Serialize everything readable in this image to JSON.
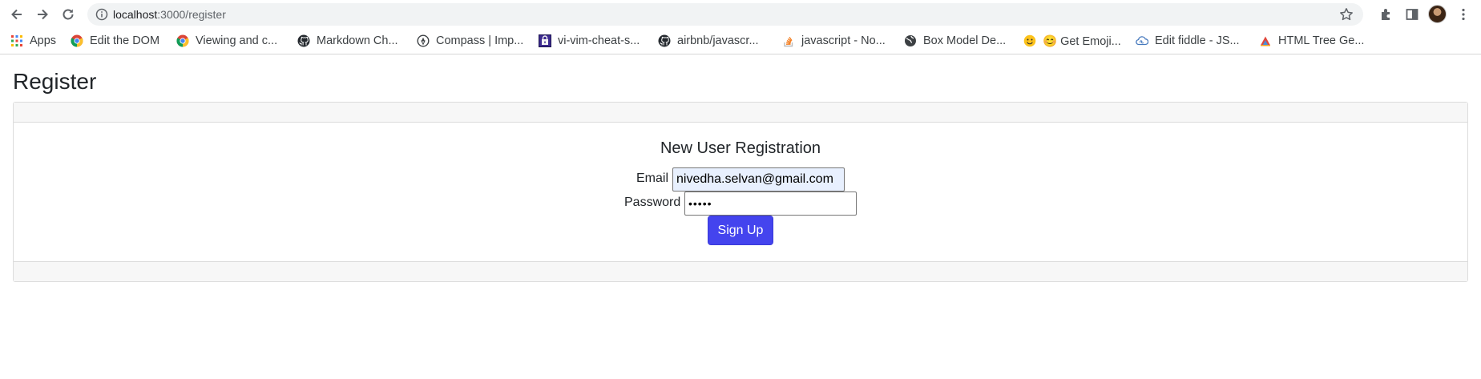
{
  "browser": {
    "url_host": "localhost",
    "url_path": ":3000/register"
  },
  "bookmarks": [
    {
      "label": "Apps",
      "icon": "apps-grid-icon"
    },
    {
      "label": "Edit the DOM",
      "icon": "chrome-icon"
    },
    {
      "label": "Viewing and c...",
      "icon": "chrome-icon"
    },
    {
      "label": "Markdown Ch...",
      "icon": "github-icon"
    },
    {
      "label": "Compass | Imp...",
      "icon": "compass-icon"
    },
    {
      "label": "vi-vim-cheat-s...",
      "icon": "vim-icon"
    },
    {
      "label": "airbnb/javascr...",
      "icon": "github-icon"
    },
    {
      "label": "javascript - No...",
      "icon": "stackoverflow-icon"
    },
    {
      "label": "Box Model De...",
      "icon": "globe-icon"
    },
    {
      "label": "😊 Get Emoji...",
      "icon": "emoji-icon"
    },
    {
      "label": "Edit fiddle - JS...",
      "icon": "jsfiddle-icon"
    },
    {
      "label": "HTML Tree Ge...",
      "icon": "html-tree-icon"
    }
  ],
  "page": {
    "title": "Register",
    "form_title": "New User Registration",
    "email_label": "Email",
    "email_value": "nivedha.selvan@gmail.com",
    "password_label": "Password",
    "password_value": "•••••",
    "signup_label": "Sign Up"
  },
  "colors": {
    "signup_button": "#4444ee",
    "autofill_bg": "#e8f0fe"
  }
}
